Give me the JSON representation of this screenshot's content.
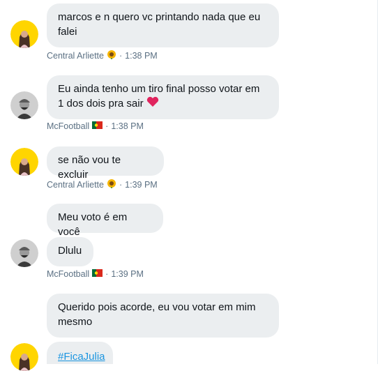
{
  "messages": [
    {
      "text": "marcos e n quero vc printando nada que eu falei"
    },
    {
      "text": "Eu ainda tenho um tiro final posso votar em 1 dos dois pra sair"
    },
    {
      "text": "se não vou te excluir"
    },
    {
      "text": "Meu voto é em você"
    },
    {
      "text": "Dlulu"
    },
    {
      "text": "Querido pois acorde, eu vou votar em mim mesmo"
    },
    {
      "text": "#FicaJulia"
    }
  ],
  "meta": [
    {
      "name": "Central Arliette",
      "time": "1:38 PM",
      "icon": "sunflower-icon"
    },
    {
      "name": "McFootball",
      "time": "1:38 PM",
      "icon": "portugal-flag-icon"
    },
    {
      "name": "Central Arliette",
      "time": "1:39 PM",
      "icon": "sunflower-icon"
    },
    {
      "name": "McFootball",
      "time": "1:39 PM",
      "icon": "portugal-flag-icon"
    }
  ],
  "separator": "·",
  "colors": {
    "bubble": "#ebeef0",
    "meta_text": "#5b7083",
    "link": "#1b95e0",
    "avatar_yellow": "#ffd500"
  }
}
